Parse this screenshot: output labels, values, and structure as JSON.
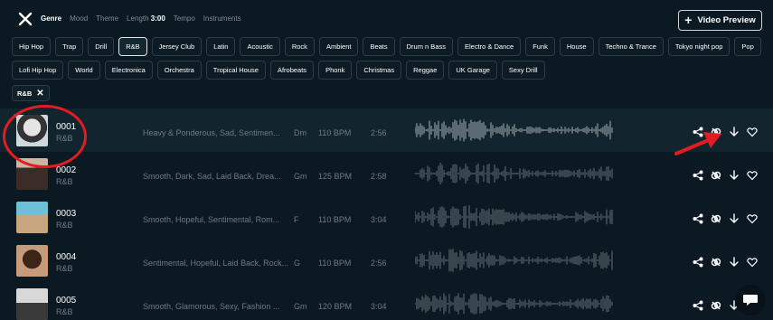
{
  "filters": {
    "tabs": [
      {
        "label": "Genre",
        "active": true
      },
      {
        "label": "Mood"
      },
      {
        "label": "Theme"
      },
      {
        "label": "Length",
        "value": "3:00"
      },
      {
        "label": "Tempo"
      },
      {
        "label": "Instruments"
      }
    ]
  },
  "header": {
    "preview_label": "Video Preview"
  },
  "genres_row1": [
    "Hip Hop",
    "Trap",
    "Drill",
    "R&B",
    "Jersey Club",
    "Latin",
    "Acoustic",
    "Rock",
    "Ambient",
    "Beats",
    "Drum n Bass",
    "Electro & Dance",
    "Funk",
    "House",
    "Techno & Trance",
    "Tokyo night pop",
    "Pop"
  ],
  "genres_row2": [
    "Lofi Hip Hop",
    "World",
    "Electronica",
    "Orchestra",
    "Tropical House",
    "Afrobeats",
    "Phonk",
    "Christmas",
    "Reggae",
    "UK Garage",
    "Sexy Drill"
  ],
  "selected_genre": "R&B",
  "selected_chip": "R&B",
  "tracks": [
    {
      "code": "0001",
      "genre": "R&B",
      "moods": "Heavy & Ponderous, Sad, Sentimen...",
      "key": "Dm",
      "bpm": "110 BPM",
      "duration": "2:56"
    },
    {
      "code": "0002",
      "genre": "R&B",
      "moods": "Smooth, Dark, Sad, Laid Back, Drea...",
      "key": "Gm",
      "bpm": "125 BPM",
      "duration": "2:58"
    },
    {
      "code": "0003",
      "genre": "R&B",
      "moods": "Smooth, Hopeful, Sentimental, Rom...",
      "key": "F",
      "bpm": "110 BPM",
      "duration": "3:04"
    },
    {
      "code": "0004",
      "genre": "R&B",
      "moods": "Sentimental, Hopeful, Laid Back, Rock...",
      "key": "G",
      "bpm": "110 BPM",
      "duration": "2:56"
    },
    {
      "code": "0005",
      "genre": "R&B",
      "moods": "Smooth, Glamorous, Sexy, Fashion ...",
      "key": "Gm",
      "bpm": "120 BPM",
      "duration": "3:04"
    }
  ],
  "colors": {
    "accent_red": "#e31b23",
    "background": "#0b1a22"
  },
  "icons": [
    "close-icon",
    "plus-icon",
    "share-icon",
    "link-icon",
    "download-icon",
    "heart-icon",
    "chat-icon"
  ]
}
